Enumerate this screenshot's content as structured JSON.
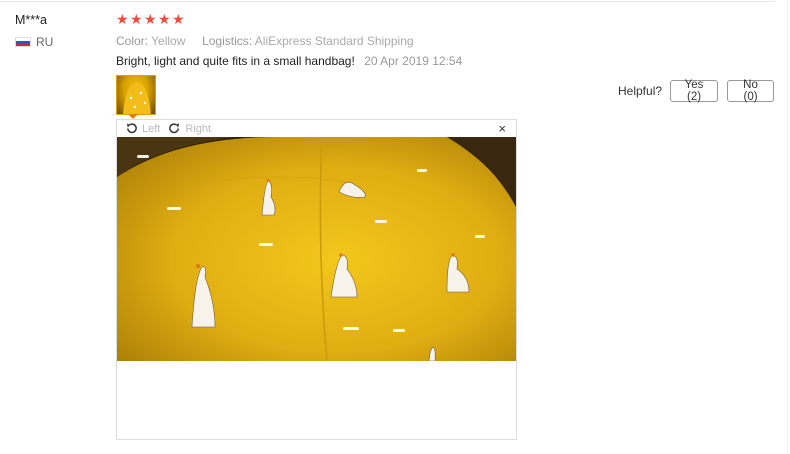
{
  "reviewer": {
    "name": "M***a",
    "country": "RU"
  },
  "rating": {
    "stars": 5,
    "max": 5,
    "color": "#f04a3c"
  },
  "attributes": {
    "color_key": "Color:",
    "color_value": "Yellow",
    "logistics_key": "Logistics:",
    "logistics_value": "AliExpress Standard Shipping"
  },
  "review": {
    "text": "Bright, light and quite fits in a small handbag!",
    "date": "20 Apr 2019 12:54"
  },
  "helpful": {
    "label": "Helpful?",
    "yes_label": "Yes (2)",
    "no_label": "No (0)"
  },
  "viewer": {
    "rotate_left": "Left",
    "rotate_right": "Right",
    "close": "×"
  },
  "colors": {
    "photo_yellow": "#e0b416",
    "accent": "#f04a3c"
  }
}
